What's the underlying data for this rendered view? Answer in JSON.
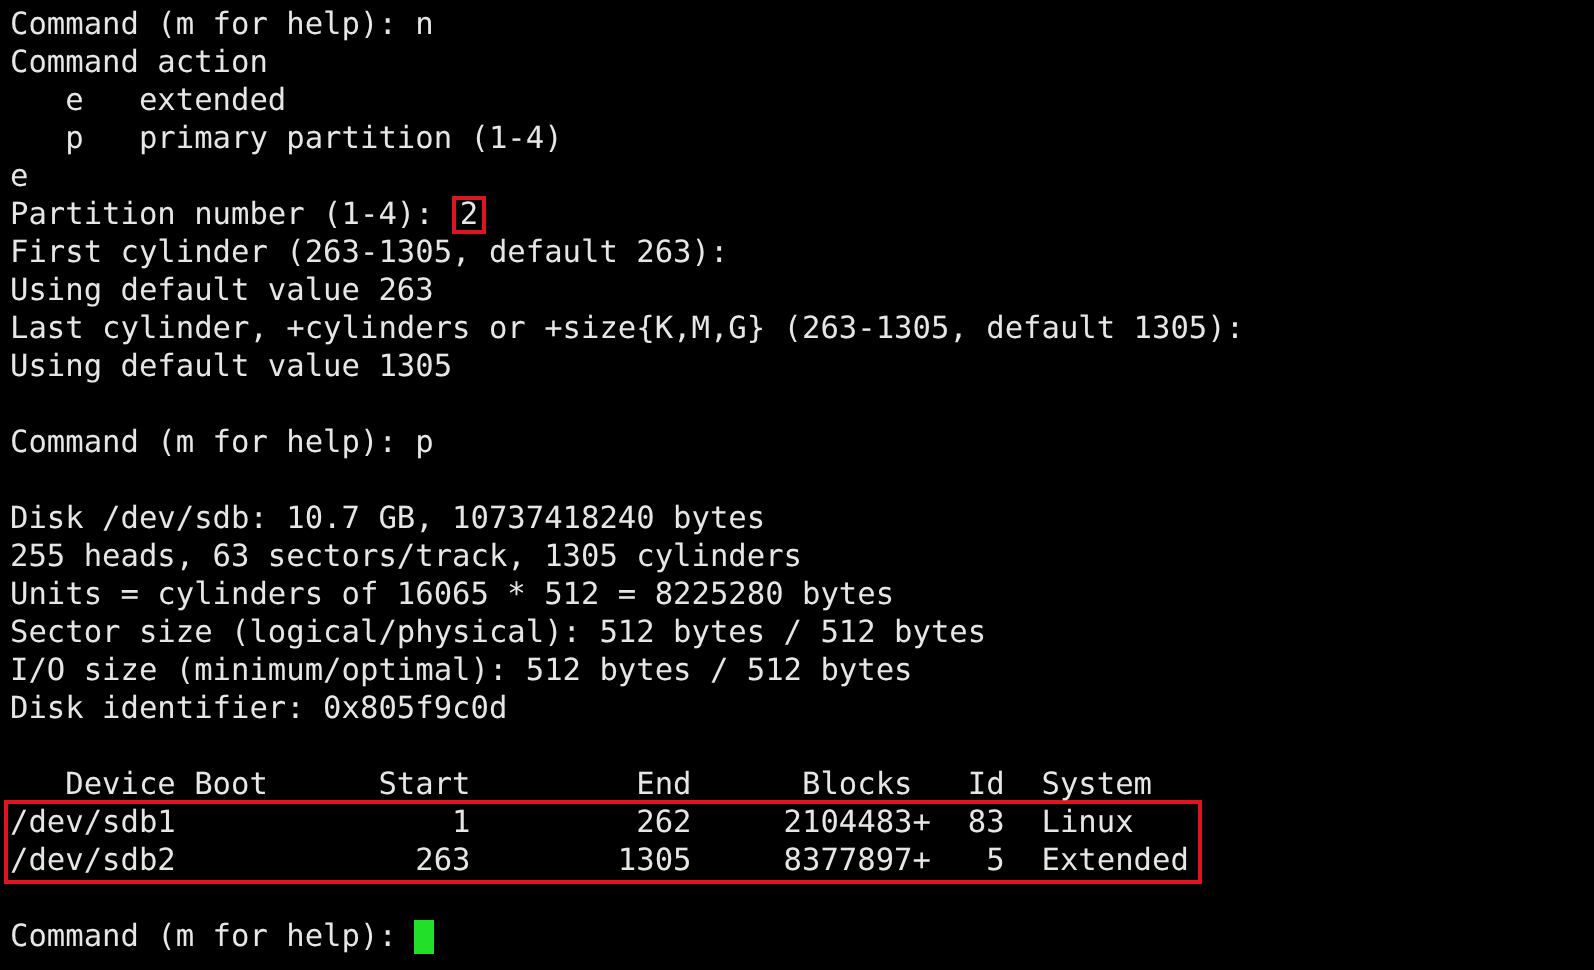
{
  "terminal": {
    "lines": [
      {
        "kind": "text",
        "text": "Command (m for help): n"
      },
      {
        "kind": "text",
        "text": "Command action"
      },
      {
        "kind": "text",
        "text": "   e   extended"
      },
      {
        "kind": "text",
        "text": "   p   primary partition (1-4)"
      },
      {
        "kind": "text",
        "text": "e"
      },
      {
        "kind": "marked_input",
        "text": "Partition number (1-4):",
        "value": "2"
      },
      {
        "kind": "text",
        "text": "First cylinder (263-1305, default 263):"
      },
      {
        "kind": "text",
        "text": "Using default value 263"
      },
      {
        "kind": "text",
        "text": "Last cylinder, +cylinders or +size{K,M,G} (263-1305, default 1305):"
      },
      {
        "kind": "text",
        "text": "Using default value 1305"
      },
      {
        "kind": "blank"
      },
      {
        "kind": "text",
        "text": "Command (m for help): p"
      },
      {
        "kind": "blank"
      },
      {
        "kind": "text",
        "text": "Disk /dev/sdb: 10.7 GB, 10737418240 bytes"
      },
      {
        "kind": "text",
        "text": "255 heads, 63 sectors/track, 1305 cylinders"
      },
      {
        "kind": "text",
        "text": "Units = cylinders of 16065 * 512 = 8225280 bytes"
      },
      {
        "kind": "text",
        "text": "Sector size (logical/physical): 512 bytes / 512 bytes"
      },
      {
        "kind": "text",
        "text": "I/O size (minimum/optimal): 512 bytes / 512 bytes"
      },
      {
        "kind": "text",
        "text": "Disk identifier: 0x805f9c0d"
      },
      {
        "kind": "blank"
      },
      {
        "kind": "text",
        "text": "   Device Boot      Start         End      Blocks   Id  System"
      },
      {
        "kind": "marked_group",
        "lines": [
          "/dev/sdb1               1         262     2104483+  83  Linux",
          "/dev/sdb2             263        1305     8377897+   5  Extended"
        ]
      },
      {
        "kind": "blank"
      },
      {
        "kind": "cursor_prompt",
        "text": "Command (m for help):"
      }
    ]
  }
}
